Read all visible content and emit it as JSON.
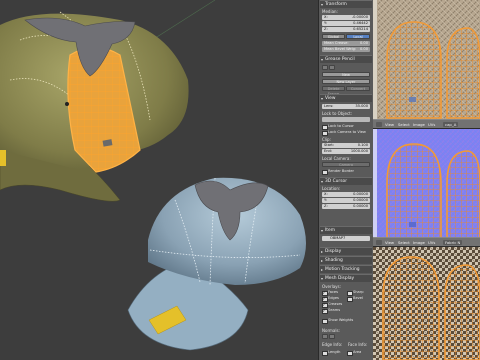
{
  "panel": {
    "transform": {
      "header": "Transform",
      "median_label": "Median:",
      "x_key": "X:",
      "x_val": "-0.00000",
      "y_key": "Y:",
      "y_val": "0.46442",
      "z_key": "Z:",
      "z_val": "0.65214",
      "global_label": "Global",
      "local_label": "Local",
      "mean_crease_label": "Mean Crease:",
      "mean_crease_val": "0.00",
      "mean_bevel_label": "Mean Bevel Weig:",
      "mean_bevel_val": "0.00"
    },
    "grease_pencil": {
      "header": "Grease Pencil",
      "new_label": "New",
      "new_layer_label": "New Layer",
      "delete_frame_label": "Delete Frame",
      "convert_label": "Convert"
    },
    "view": {
      "header": "View",
      "lens_label": "Lens:",
      "lens_val": "35.000",
      "lock_to_object_label": "Lock to Object:",
      "lock_to_cursor_label": "Lock to Cursor",
      "lock_camera_label": "Lock Camera to View",
      "clip_label": "Clip:",
      "clip_start_key": "Start:",
      "clip_start_val": "0.100",
      "clip_end_key": "End:",
      "clip_end_val": "1000.000",
      "local_camera_label": "Local Camera:",
      "camera_label": "Camera",
      "render_border_label": "Render Border"
    },
    "cursor": {
      "header": "3D Cursor",
      "location_label": "Location:",
      "x_key": "X:",
      "x_val": "0.00000",
      "y_key": "Y:",
      "y_val": "0.00000",
      "z_key": "Z:",
      "z_val": "0.00000"
    },
    "item": {
      "header": "Item",
      "name_val": "OBMAP7"
    },
    "display": {
      "header": "Display"
    },
    "shading": {
      "header": "Shading"
    },
    "motion_tracking": {
      "header": "Motion Tracking"
    },
    "mesh_display": {
      "header": "Mesh Display",
      "overlays_label": "Overlays:",
      "faces_label": "Faces",
      "sharp_label": "Sharp",
      "edges_label": "Edges",
      "bevel_label": "Bevel",
      "creases_label": "Creases",
      "seams_label": "Seams",
      "show_weights_label": "Show Weights",
      "normals_label": "Normals:",
      "edge_info_label": "Edge Info:",
      "face_info_label": "Face Info:",
      "length_label": "Length",
      "area_label": "Area"
    }
  },
  "image_editors": [
    {
      "menus": [
        "View",
        "Select",
        "Image",
        "UVs"
      ],
      "filename": "cap_A"
    },
    {
      "menus": [
        "View",
        "Select",
        "Image",
        "UVs"
      ],
      "filename": "Fabric N"
    },
    {
      "menus": [
        "View",
        "Select",
        "Image",
        "UVs"
      ],
      "filename": "Fabric C"
    }
  ],
  "colors": {
    "hat_olive": "#8f8c55",
    "hat_blue": "#8aa2b4",
    "selection_orange": "#f0a030",
    "badge_yellow": "#e4c02a",
    "bow_gray": "#6f6f73",
    "normal_map_blue": "#7f7ff6",
    "tweed": "#b9a893"
  }
}
